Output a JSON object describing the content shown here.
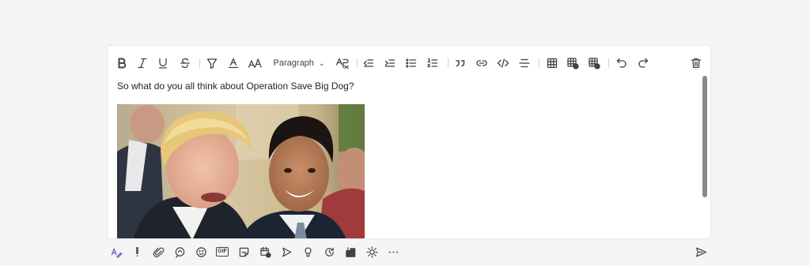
{
  "toolbar": {
    "paragraph_label": "Paragraph",
    "icons": [
      "bold-icon",
      "italic-icon",
      "underline-icon",
      "strikethrough-icon",
      "highlight-icon",
      "font-color-icon",
      "font-size-icon",
      "paragraph-style-dropdown",
      "clear-formatting-icon",
      "decrease-indent-icon",
      "increase-indent-icon",
      "bulleted-list-icon",
      "numbered-list-icon",
      "quote-icon",
      "link-icon",
      "code-snippet-icon",
      "horizontal-rule-icon",
      "insert-table-icon",
      "insert-row-icon",
      "delete-table-icon",
      "undo-icon",
      "redo-icon",
      "delete-icon"
    ]
  },
  "message": {
    "text": "So what do you all think about Operation Save Big Dog?"
  },
  "attachment": {
    "alt": "photo-of-two-men-laughing"
  },
  "bottombar": {
    "gif_label": "GIF",
    "icons": [
      "format-icon",
      "important-icon",
      "attach-icon",
      "loop-icon",
      "emoji-icon",
      "gif-icon",
      "sticker-icon",
      "schedule-meeting-icon",
      "stream-icon",
      "praise-icon",
      "updates-icon",
      "approvals-icon",
      "brightness-icon",
      "more-options-icon",
      "send-icon"
    ]
  },
  "colors": {
    "accent": "#5b5fc7",
    "background": "#f5f5f5",
    "surface": "#ffffff"
  }
}
